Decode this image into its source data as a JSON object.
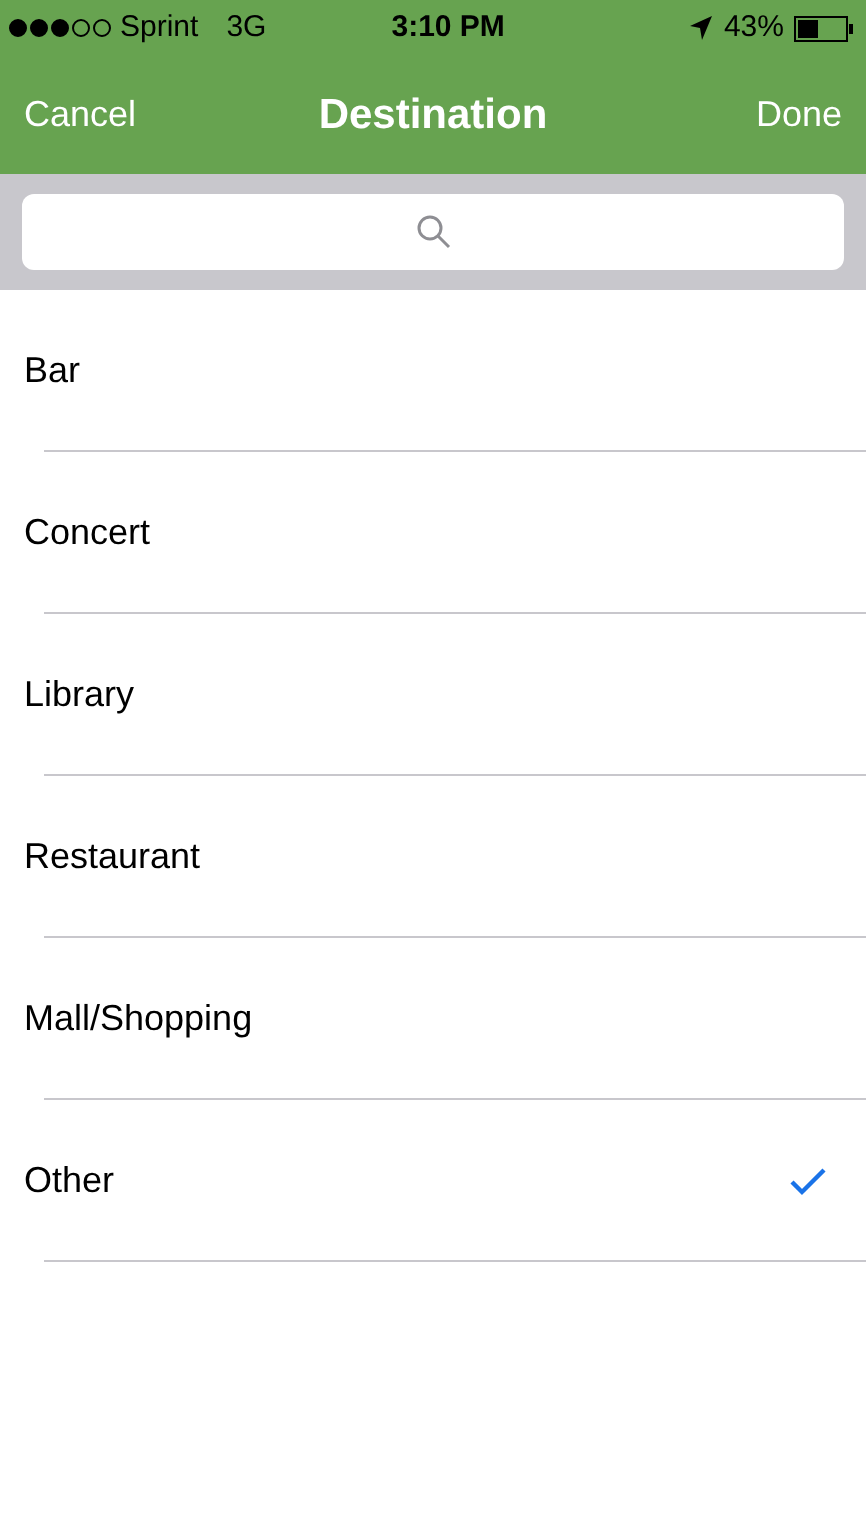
{
  "status_bar": {
    "carrier": "Sprint",
    "network": "3G",
    "time": "3:10 PM",
    "battery": "43%"
  },
  "nav": {
    "left": "Cancel",
    "title": "Destination",
    "right": "Done"
  },
  "items": [
    {
      "label": "Bar",
      "selected": false
    },
    {
      "label": "Concert",
      "selected": false
    },
    {
      "label": "Library",
      "selected": false
    },
    {
      "label": "Restaurant",
      "selected": false
    },
    {
      "label": "Mall/Shopping",
      "selected": false
    },
    {
      "label": "Other",
      "selected": true
    }
  ]
}
